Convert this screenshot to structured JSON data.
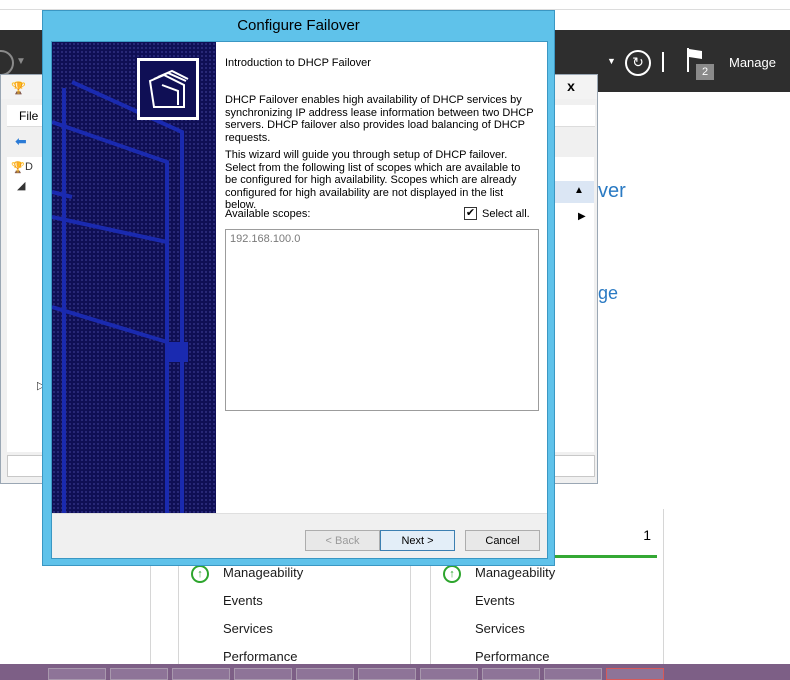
{
  "background": {
    "header": {
      "manage_label": "Manage",
      "notification_count": "2"
    },
    "right_fragments": [
      "ver",
      "ge"
    ],
    "tiles": [
      {
        "count": "",
        "rows": [
          "Manageability",
          "Events",
          "Services",
          "Performance"
        ]
      },
      {
        "count": "1",
        "rows": [
          "Manageability",
          "Events",
          "Services",
          "Performance"
        ]
      }
    ],
    "mmc": {
      "close_glyph": "x",
      "menu_file": "File",
      "tree_item": "D"
    }
  },
  "wizard": {
    "title": "Configure Failover",
    "heading": "Introduction to DHCP Failover",
    "para1": "DHCP Failover enables high availability of DHCP services by synchronizing IP address lease information between two DHCP servers. DHCP failover also provides load balancing of DHCP requests.",
    "para2": "This wizard will guide you through setup of DHCP failover. Select from the following list of scopes which are available to be configured for high availability. Scopes which are already configured for high availability are not displayed in the list below.",
    "available_label": "Available scopes:",
    "select_all_label": "Select all.",
    "select_all_checked": "✔",
    "scopes": [
      "192.168.100.0"
    ],
    "buttons": {
      "back": "< Back",
      "next": "Next >",
      "cancel": "Cancel"
    }
  },
  "colors": {
    "wizard_frame": "#5fc2ea",
    "art_background": "#0f0f55",
    "art_lines": "#1a2ab0",
    "header_dark": "#2e2e2e",
    "link_blue": "#2a7ac3",
    "status_green": "#34a834"
  }
}
